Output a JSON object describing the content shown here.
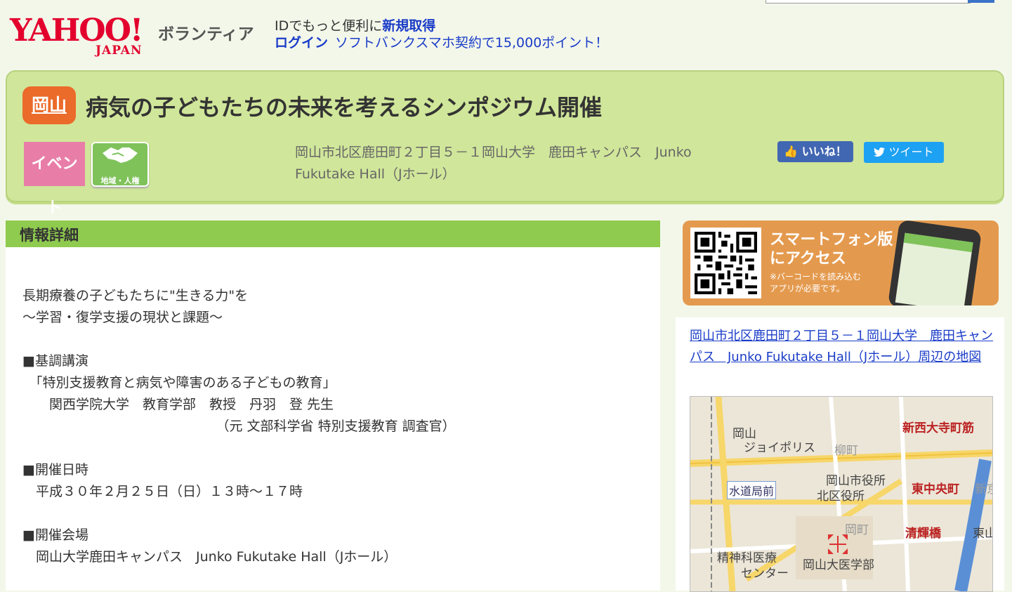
{
  "header": {
    "logo_main": "YAHOO!",
    "logo_sub": "JAPAN",
    "brand": "ボランティア",
    "signup_prefix": "IDでもっと便利に",
    "signup_link": "新規取得",
    "login_link": "ログイン",
    "promo_link": "ソフトバンクスマホ契約で15,000ポイント！"
  },
  "event": {
    "prefecture": "岡山",
    "title": "病気の子どもたちの未来を考えるシンポジウム開催",
    "tag_type": "イベント",
    "tag_category": "地域・人権",
    "address": "岡山市北区鹿田町２丁目５－１岡山大学　鹿田キャンパス　Junko Fukutake Hall（Jホール）",
    "like_label": "いいね！",
    "tweet_label": "ツイート"
  },
  "detail": {
    "heading": "情報詳細",
    "body": "長期療養の子どもたちに\"生きる力\"を\n～学習・復学支援の現状と課題～\n\n■基調講演\n　「特別支援教育と病気や障害のある子どもの教育」\n　　関西学院大学　教育学部　教授　丹羽　登 先生\n　　　　　　　　　　　　　　　（元 文部科学省 特別支援教育 調査官）\n\n■開催日時\n　平成３０年２月２５日（日）１３時～１７時\n\n■開催会場\n　岡山大学鹿田キャンパス　Junko Fukutake Hall（Jホール）"
  },
  "sidebar": {
    "sp_title_1": "スマートフォン版",
    "sp_title_2": "にアクセス",
    "sp_note_1": "※バーコードを読み込む",
    "sp_note_2": "アプリが必要です。",
    "map_link": "岡山市北区鹿田町２丁目５－１岡山大学　鹿田キャンパス　Junko Fukutake Hall（Jホール）周辺の地図",
    "map_labels": {
      "okayama": "岡山",
      "joypolis": "ジョイポリス",
      "yanagimachi": "柳町",
      "city_hall": "岡山市役所",
      "kita_ward": "北区役所",
      "suido": "水道局前",
      "shin_nishi": "新西大寺町筋",
      "higashi_chuo": "東中央町",
      "seiki": "清輝橋",
      "seishin": "精神科医療",
      "center": "センター",
      "med_school": "岡山大医学部",
      "okamachi": "岡町",
      "higashiyama": "東山",
      "shinsho": "新京"
    }
  },
  "colors": {
    "accent_green": "#8fcb4e",
    "panel_green": "#d0e69a",
    "badge_orange": "#eb6b2a",
    "link_blue": "#1a3cc8"
  }
}
